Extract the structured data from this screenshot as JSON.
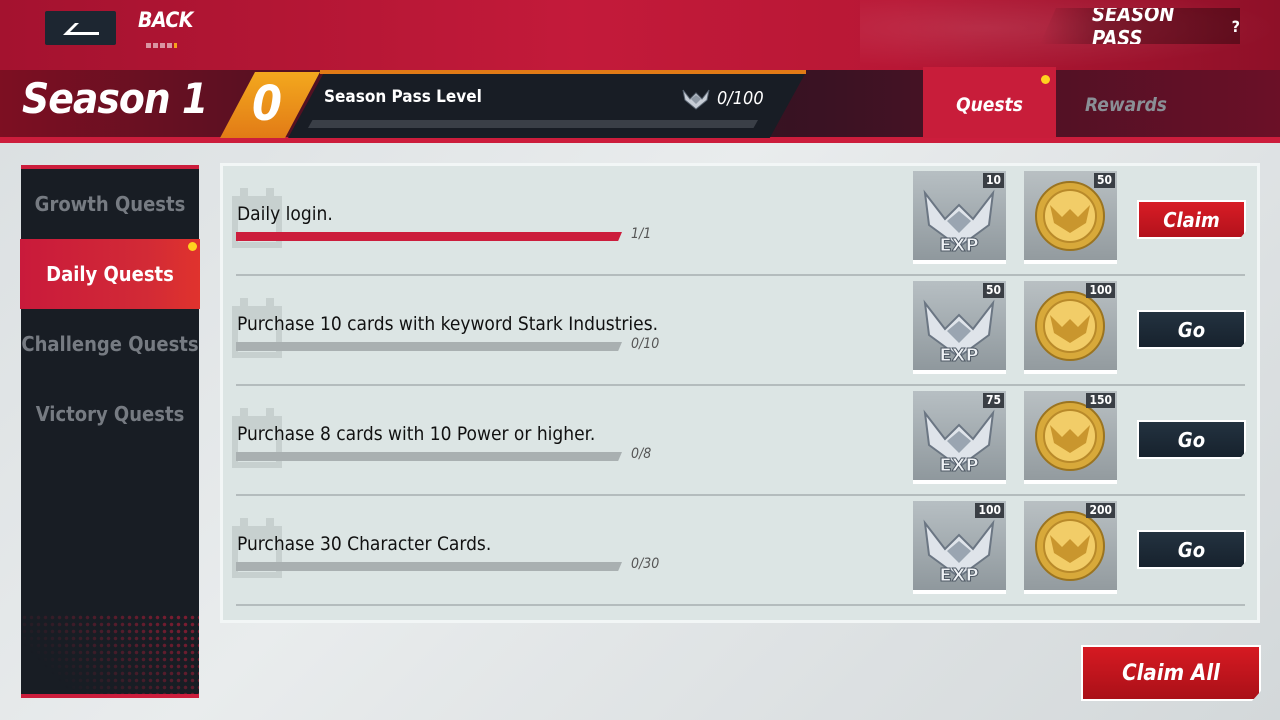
{
  "header": {
    "back_label": "BACK",
    "season_pass_title": "SEASON PASS",
    "help_icon": "?"
  },
  "season": {
    "name": "Season 1",
    "level": "0",
    "level_label": "Season Pass Level",
    "level_progress_text": "0/100",
    "level_progress_fraction": 0.0
  },
  "tabs": [
    {
      "label": "Quests",
      "active": true,
      "has_notification": true
    },
    {
      "label": "Rewards",
      "active": false,
      "has_notification": false
    }
  ],
  "sidebar": {
    "items": [
      {
        "label": "Growth Quests",
        "active": false
      },
      {
        "label": "Daily Quests",
        "active": true
      },
      {
        "label": "Challenge Quests",
        "active": false
      },
      {
        "label": "Victory Quests",
        "active": false
      }
    ]
  },
  "quests": [
    {
      "text": "Daily login.",
      "progress_text": "1/1",
      "progress_fraction": 1.0,
      "exp": "10",
      "coins": "50",
      "action": "Claim",
      "action_type": "claim"
    },
    {
      "text": "Purchase 10 cards with keyword Stark Industries.",
      "progress_text": "0/10",
      "progress_fraction": 0.0,
      "exp": "50",
      "coins": "100",
      "action": "Go",
      "action_type": "go"
    },
    {
      "text": "Purchase 8 cards with 10 Power or higher.",
      "progress_text": "0/8",
      "progress_fraction": 0.0,
      "exp": "75",
      "coins": "150",
      "action": "Go",
      "action_type": "go"
    },
    {
      "text": "Purchase 30 Character Cards.",
      "progress_text": "0/30",
      "progress_fraction": 0.0,
      "exp": "100",
      "coins": "200",
      "action": "Go",
      "action_type": "go"
    }
  ],
  "claim_all_label": "Claim All",
  "icons": {
    "back": "back-arrow-icon",
    "exp": "exp-eagle-icon",
    "coin": "gold-eagle-coin-icon"
  },
  "colors": {
    "accent_red": "#cc1d3c",
    "accent_orange": "#f3a81e",
    "notification_yellow": "#ffd21f",
    "dark_panel": "#181d24"
  }
}
